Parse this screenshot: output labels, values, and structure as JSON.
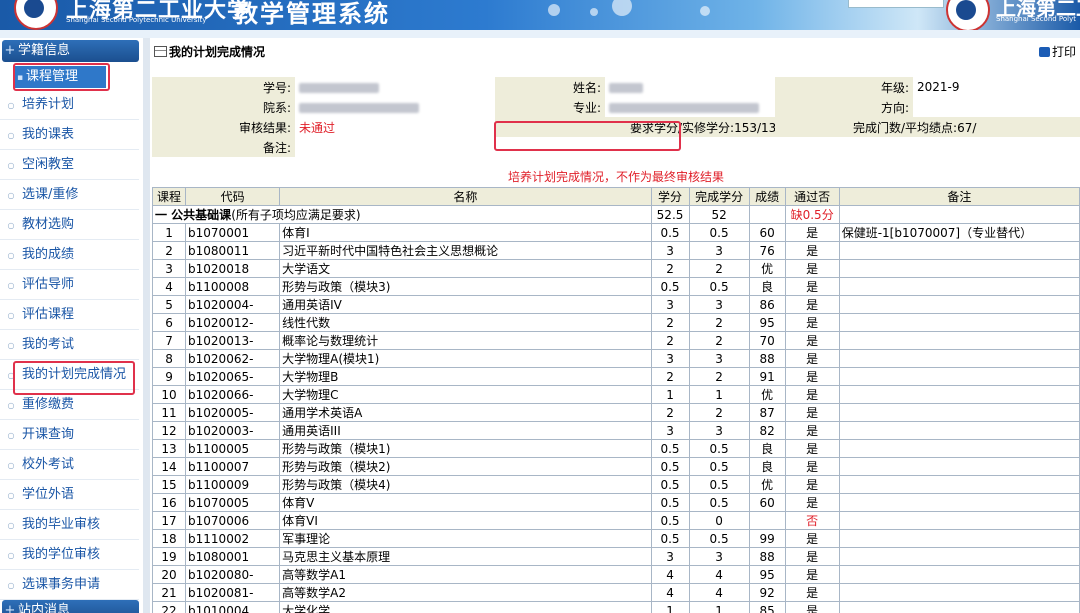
{
  "header": {
    "university_cn": "上海第二工业大学",
    "university_en": "Shanghai Second Polytechnic University",
    "system_title": "教学管理系统",
    "university_cn_right": "上海第二工",
    "university_en_right": "Shanghai Second Polyt"
  },
  "sidebar": {
    "top_header": "学籍信息",
    "category": "课程管理",
    "items": [
      {
        "label": "培养计划"
      },
      {
        "label": "我的课表"
      },
      {
        "label": "空闲教室"
      },
      {
        "label": "选课/重修"
      },
      {
        "label": "教材选购"
      },
      {
        "label": "我的成绩"
      },
      {
        "label": "评估导师"
      },
      {
        "label": "评估课程"
      },
      {
        "label": "我的考试"
      },
      {
        "label": "我的计划完成情况"
      },
      {
        "label": "重修缴费"
      },
      {
        "label": "开课查询"
      },
      {
        "label": "校外考试"
      },
      {
        "label": "学位外语"
      },
      {
        "label": "我的毕业审核"
      },
      {
        "label": "我的学位审核"
      },
      {
        "label": "选课事务申请"
      }
    ],
    "bottom_header": "站内消息"
  },
  "main": {
    "title": "我的计划完成情况",
    "print_label": "打印",
    "info": {
      "student_id_label": "学号:",
      "name_label": "姓名:",
      "grade_label": "年级:",
      "grade_value": "2021-9",
      "dept_label": "院系:",
      "major_label": "专业:",
      "direction_label": "方向:",
      "audit_label": "审核结果:",
      "audit_value": "未通过",
      "credits_label": "要求学分/实修学分:",
      "credits_value": "153/139.5",
      "courses_label": "完成门数/平均绩点:",
      "courses_value": "67/",
      "remark_label": "备注:"
    },
    "notice": "培养计划完成情况，不作为最终审核结果",
    "columns": [
      "课程",
      "代码",
      "名称",
      "学分",
      "完成学分",
      "成绩",
      "通过否",
      "备注"
    ],
    "section": {
      "title": "一 公共基础课",
      "suffix": "(所有子项均应满足要求)",
      "credits": "52.5",
      "completed": "52",
      "status": "缺0.5分"
    },
    "rows": [
      {
        "no": "1",
        "code": "b1070001",
        "name": "体育I",
        "credit": "0.5",
        "done": "0.5",
        "score": "60",
        "pass": "是",
        "remark": "保健班-1[b1070007]（专业替代）"
      },
      {
        "no": "2",
        "code": "b1080011",
        "name": "习近平新时代中国特色社会主义思想概论",
        "credit": "3",
        "done": "3",
        "score": "76",
        "pass": "是",
        "remark": ""
      },
      {
        "no": "3",
        "code": "b1020018",
        "name": "大学语文",
        "credit": "2",
        "done": "2",
        "score": "优",
        "pass": "是",
        "remark": ""
      },
      {
        "no": "4",
        "code": "b1100008",
        "name": "形势与政策（模块3)",
        "credit": "0.5",
        "done": "0.5",
        "score": "良",
        "pass": "是",
        "remark": ""
      },
      {
        "no": "5",
        "code": "b1020004-",
        "name": "通用英语IV",
        "credit": "3",
        "done": "3",
        "score": "86",
        "pass": "是",
        "remark": ""
      },
      {
        "no": "6",
        "code": "b1020012-",
        "name": "线性代数",
        "credit": "2",
        "done": "2",
        "score": "95",
        "pass": "是",
        "remark": ""
      },
      {
        "no": "7",
        "code": "b1020013-",
        "name": "概率论与数理统计",
        "credit": "2",
        "done": "2",
        "score": "70",
        "pass": "是",
        "remark": ""
      },
      {
        "no": "8",
        "code": "b1020062-",
        "name": "大学物理A(模块1)",
        "credit": "3",
        "done": "3",
        "score": "88",
        "pass": "是",
        "remark": ""
      },
      {
        "no": "9",
        "code": "b1020065-",
        "name": "大学物理B",
        "credit": "2",
        "done": "2",
        "score": "91",
        "pass": "是",
        "remark": ""
      },
      {
        "no": "10",
        "code": "b1020066-",
        "name": "大学物理C",
        "credit": "1",
        "done": "1",
        "score": "优",
        "pass": "是",
        "remark": ""
      },
      {
        "no": "11",
        "code": "b1020005-",
        "name": "通用学术英语A",
        "credit": "2",
        "done": "2",
        "score": "87",
        "pass": "是",
        "remark": ""
      },
      {
        "no": "12",
        "code": "b1020003-",
        "name": "通用英语III",
        "credit": "3",
        "done": "3",
        "score": "82",
        "pass": "是",
        "remark": ""
      },
      {
        "no": "13",
        "code": "b1100005",
        "name": "形势与政策（模块1)",
        "credit": "0.5",
        "done": "0.5",
        "score": "良",
        "pass": "是",
        "remark": ""
      },
      {
        "no": "14",
        "code": "b1100007",
        "name": "形势与政策（模块2)",
        "credit": "0.5",
        "done": "0.5",
        "score": "良",
        "pass": "是",
        "remark": ""
      },
      {
        "no": "15",
        "code": "b1100009",
        "name": "形势与政策（模块4)",
        "credit": "0.5",
        "done": "0.5",
        "score": "优",
        "pass": "是",
        "remark": ""
      },
      {
        "no": "16",
        "code": "b1070005",
        "name": "体育V",
        "credit": "0.5",
        "done": "0.5",
        "score": "60",
        "pass": "是",
        "remark": ""
      },
      {
        "no": "17",
        "code": "b1070006",
        "name": "体育VI",
        "credit": "0.5",
        "done": "0",
        "score": "",
        "pass": "否",
        "remark": ""
      },
      {
        "no": "18",
        "code": "b1110002",
        "name": "军事理论",
        "credit": "0.5",
        "done": "0.5",
        "score": "99",
        "pass": "是",
        "remark": ""
      },
      {
        "no": "19",
        "code": "b1080001",
        "name": "马克思主义基本原理",
        "credit": "3",
        "done": "3",
        "score": "88",
        "pass": "是",
        "remark": ""
      },
      {
        "no": "20",
        "code": "b1020080-",
        "name": "高等数学A1",
        "credit": "4",
        "done": "4",
        "score": "95",
        "pass": "是",
        "remark": ""
      },
      {
        "no": "21",
        "code": "b1020081-",
        "name": "高等数学A2",
        "credit": "4",
        "done": "4",
        "score": "92",
        "pass": "是",
        "remark": ""
      },
      {
        "no": "22",
        "code": "b1010004",
        "name": "大学化学",
        "credit": "1",
        "done": "1",
        "score": "85",
        "pass": "是",
        "remark": ""
      }
    ]
  },
  "colors": {
    "accent": "#1b4f8f",
    "highlight_border": "#e0314b",
    "fail_text": "#e0202a",
    "label_bg": "#eeedda"
  }
}
